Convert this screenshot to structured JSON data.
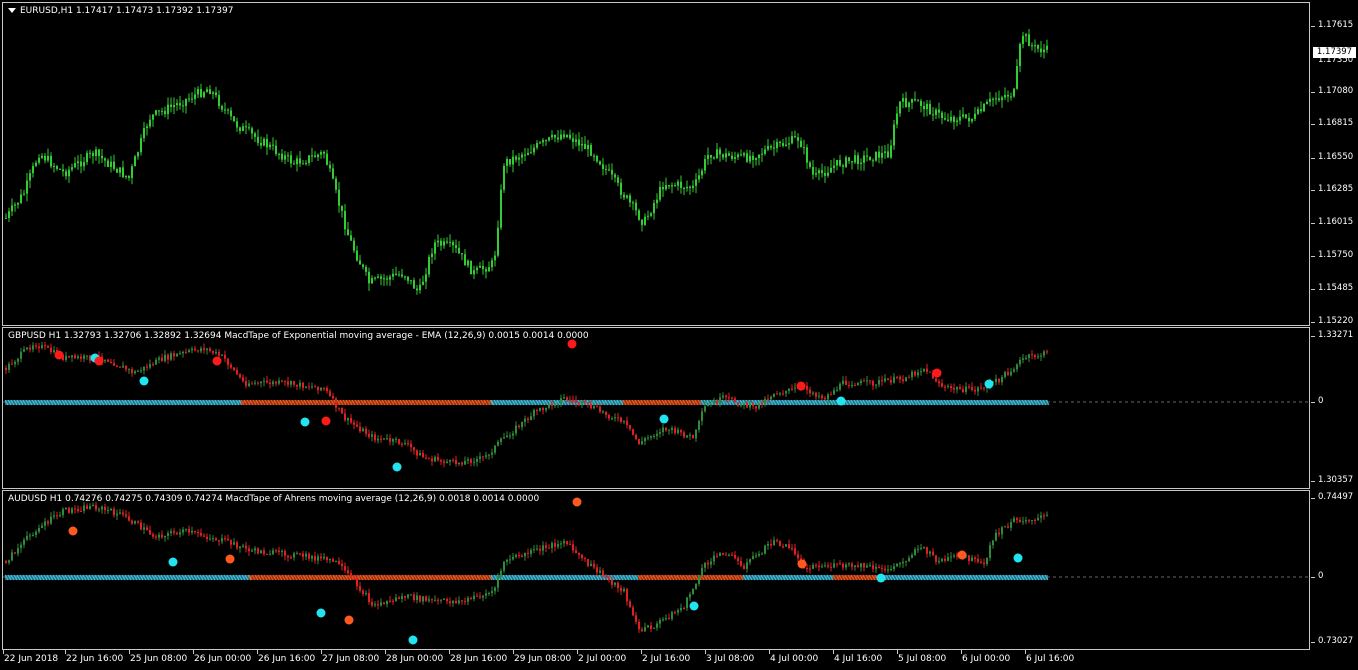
{
  "main": {
    "title": "EURUSD,H1  1.17417 1.17473 1.17392 1.17397",
    "current_price": "1.17397",
    "price_labels": [
      "1.17615",
      "1.17350",
      "1.17080",
      "1.16815",
      "1.16550",
      "1.16285",
      "1.16015",
      "1.15750",
      "1.15485",
      "1.15220"
    ],
    "colors": {
      "up": "#32cd32",
      "down": "#32cd32"
    }
  },
  "gbp": {
    "title": "GBPUSD H1  1.32793 1.32706 1.32892 1.32694  MacdTape of Exponential moving average - EMA (12,26,9) 0.0015 0.0014 0.0000",
    "labels": [
      "1.33271",
      "0",
      "1.30357"
    ],
    "colors": {
      "up": "#2e8b3a",
      "down": "#e02020",
      "tape_pos": "#40c8e8",
      "tape_neg": "#ff5a1e",
      "dot_buy": "#22e4f0",
      "dot_sell": "#ff1a1a"
    }
  },
  "aud": {
    "title": "AUDUSD H1  0.74276 0.74275 0.74309 0.74274  MacdTape of Ahrens moving average (12,26,9) 0.0018 0.0014 0.0000",
    "labels": [
      "0.74497",
      "0",
      "0.73027"
    ],
    "colors": {
      "up": "#2e8b3a",
      "down": "#e02020",
      "tape_pos": "#40c8e8",
      "tape_neg": "#ff5a1e",
      "dot_buy": "#22e4f0",
      "dot_sell": "#ff5a1e"
    }
  },
  "time_axis": [
    "22 Jun 2018",
    "22 Jun 16:00",
    "25 Jun 08:00",
    "26 Jun 00:00",
    "26 Jun 16:00",
    "27 Jun 08:00",
    "28 Jun 00:00",
    "28 Jun 16:00",
    "29 Jun 08:00",
    "2 Jul 00:00",
    "2 Jul 16:00",
    "3 Jul 08:00",
    "4 Jul 00:00",
    "4 Jul 16:00",
    "5 Jul 08:00",
    "6 Jul 00:00",
    "6 Jul 16:00"
  ]
}
